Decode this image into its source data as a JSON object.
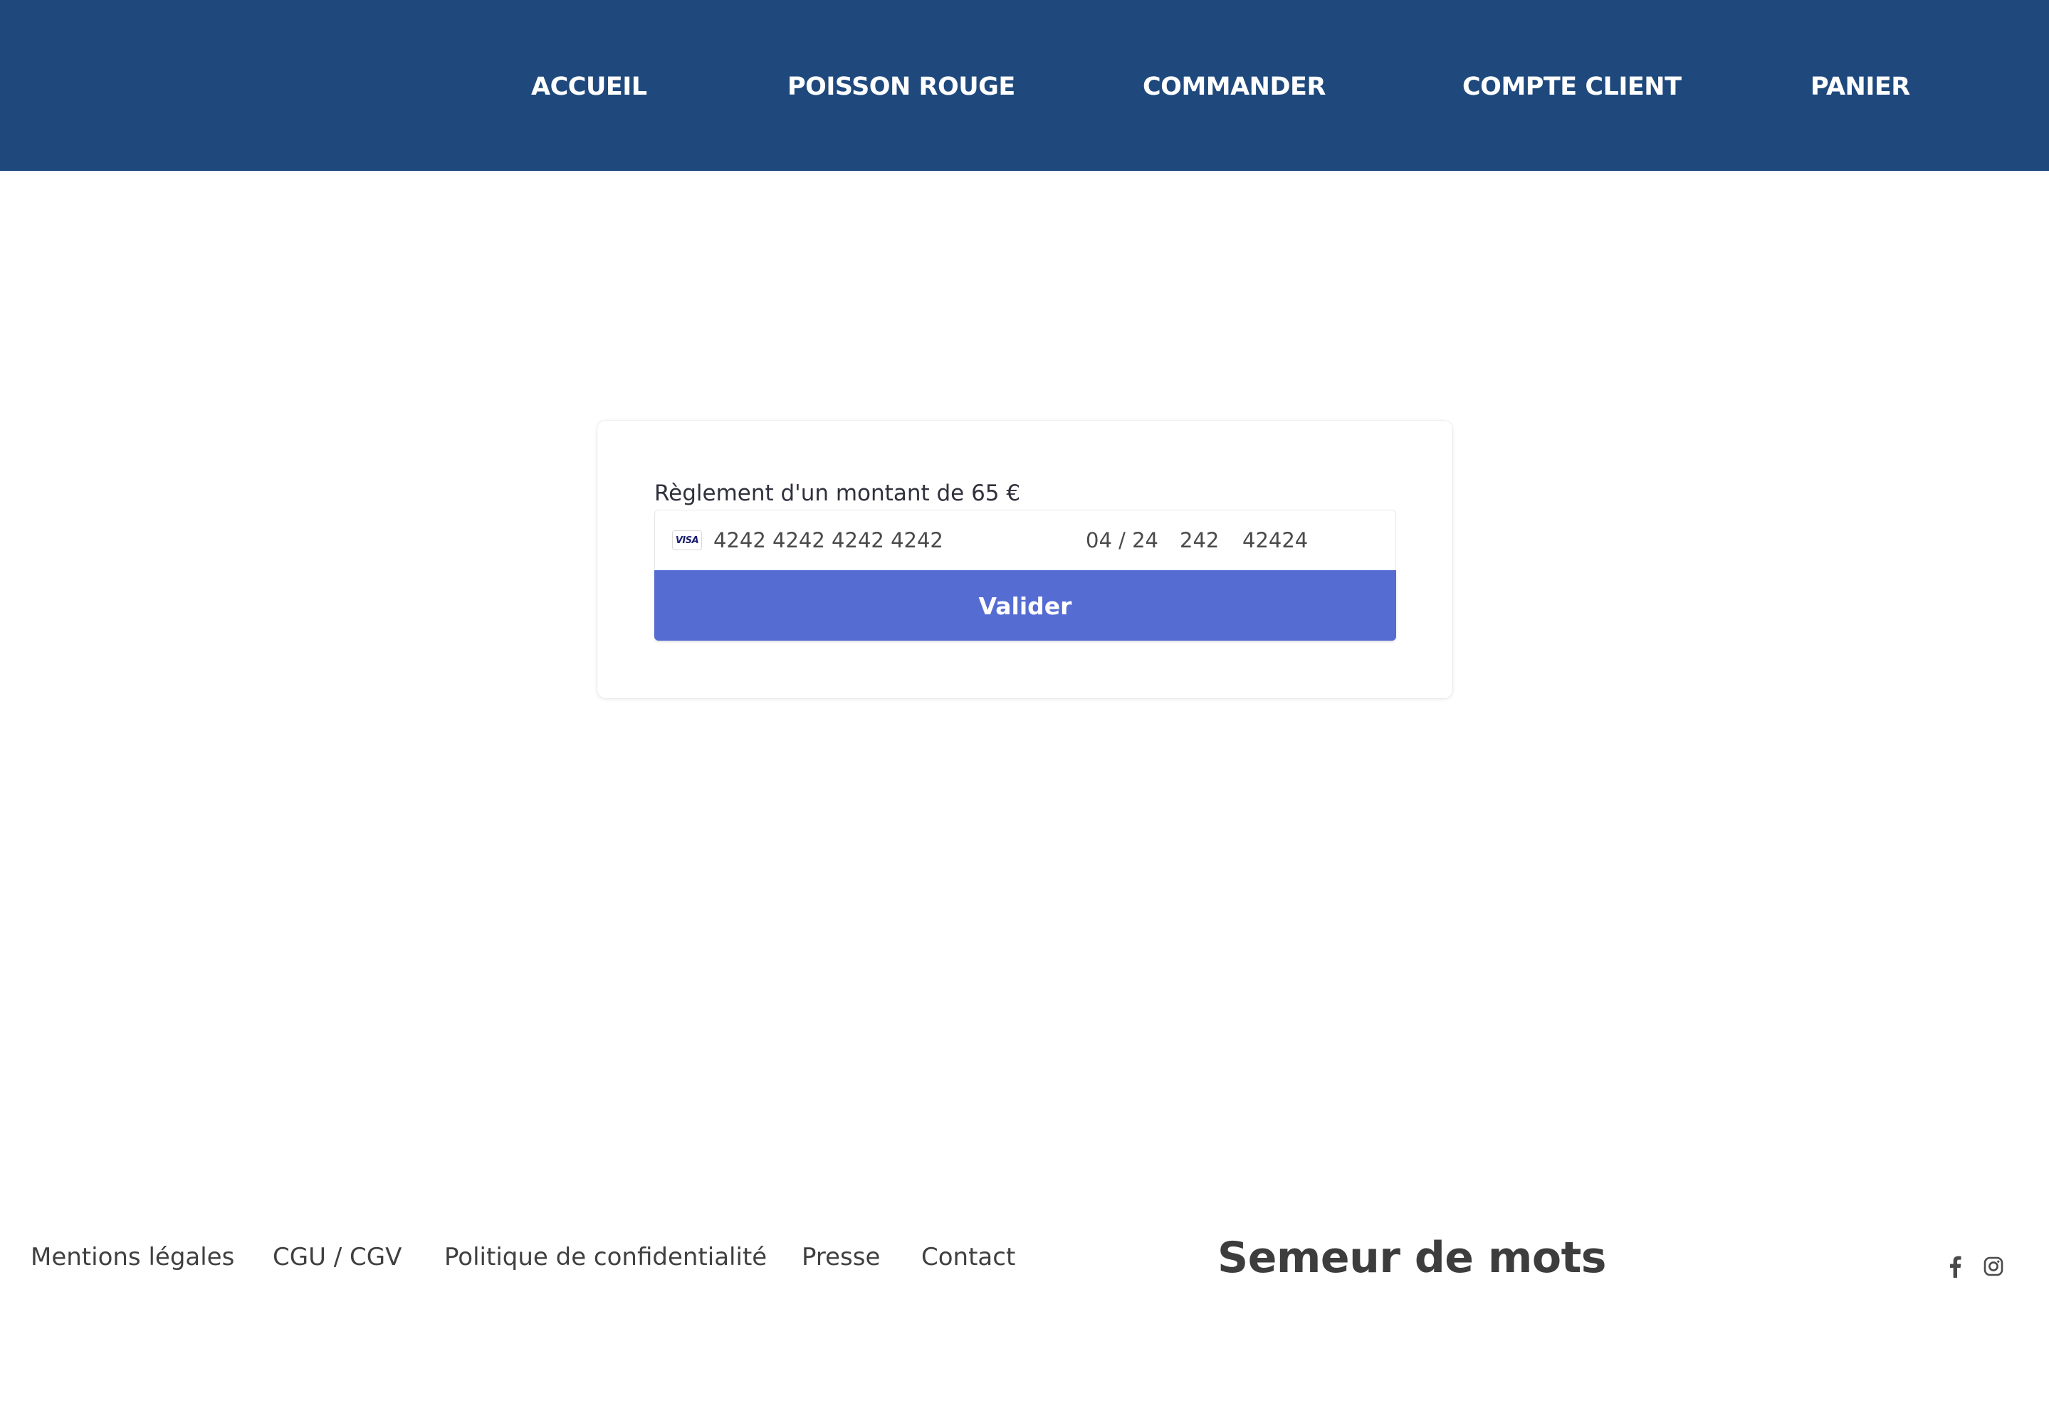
{
  "header": {
    "nav": [
      {
        "label": "ACCUEIL"
      },
      {
        "label": "POISSON ROUGE"
      },
      {
        "label": "COMMANDER"
      },
      {
        "label": "COMPTE CLIENT"
      },
      {
        "label": "PANIER"
      }
    ],
    "background_color": "#1f497d"
  },
  "payment": {
    "amount_label": "Règlement d'un montant de 65 €",
    "card_brand": "VISA",
    "card_number": "4242 4242 4242 4242",
    "expiry": "04 / 24",
    "cvc": "242",
    "postal_code": "42424",
    "submit_label": "Valider",
    "button_color": "#556cd3",
    "card_brand_icon": "visa-icon"
  },
  "footer": {
    "links": [
      {
        "label": "Mentions légales"
      },
      {
        "label": "CGU / CGV"
      },
      {
        "label": "Politique de confidentialité"
      },
      {
        "label": "Presse"
      },
      {
        "label": "Contact"
      }
    ],
    "brand": "Semeur de mots",
    "social": [
      {
        "icon": "facebook-icon"
      },
      {
        "icon": "instagram-icon"
      }
    ]
  }
}
